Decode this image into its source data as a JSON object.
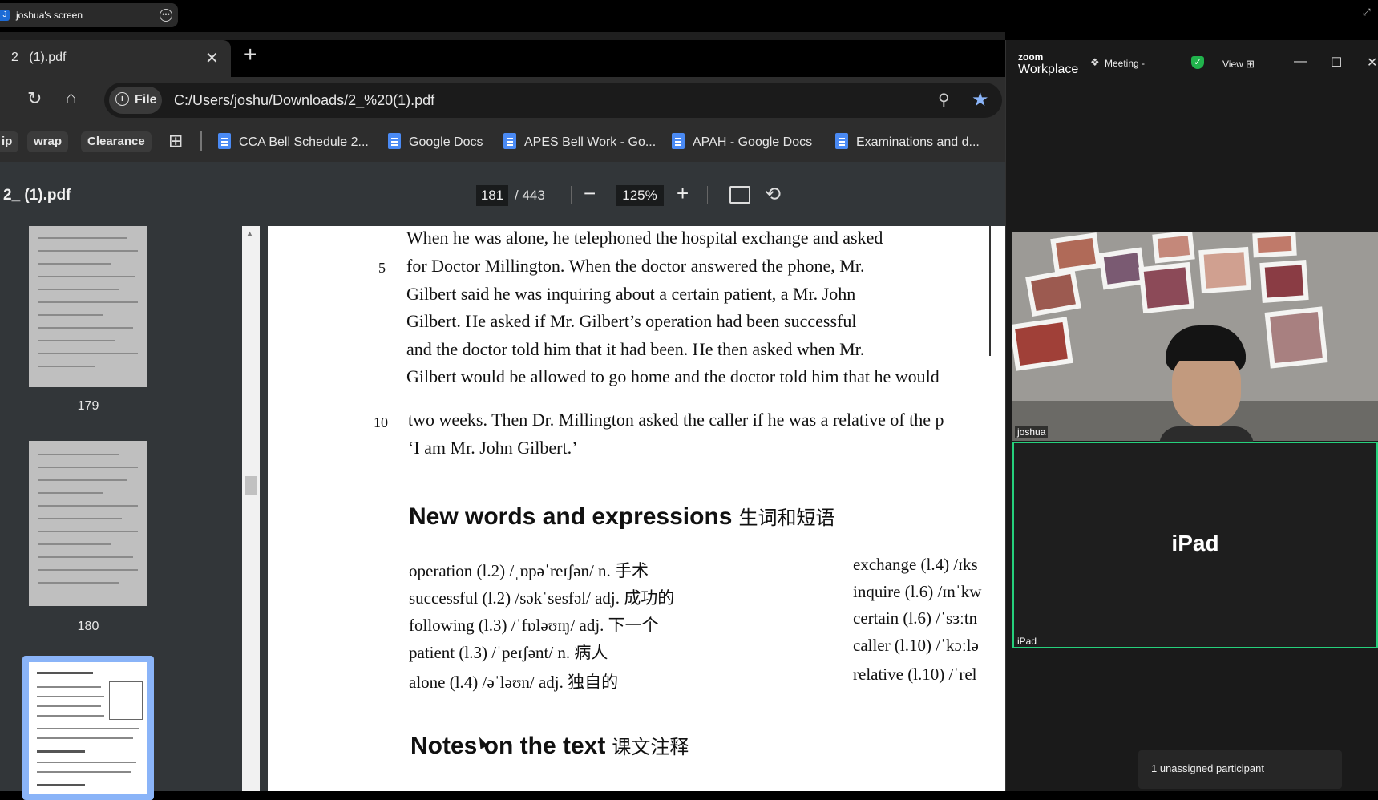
{
  "share": {
    "title": "joshua's screen",
    "icon_letter": "J"
  },
  "browser": {
    "tab_title": "2_ (1).pdf",
    "file_chip": "File",
    "url": "C:/Users/joshu/Downloads/2_%20(1).pdf",
    "bookmarks_chips": [
      "ip",
      "wrap",
      "Clearance"
    ],
    "bookmarks": [
      "CCA Bell Schedule 2...",
      "Google Docs",
      "APES Bell Work - Go...",
      "APAH - Google Docs",
      "Examinations and d..."
    ]
  },
  "pdf": {
    "title": "2_ (1).pdf",
    "current_page": "181",
    "total_pages": "/ 443",
    "zoom": "125%",
    "thumbnails": [
      "179",
      "180"
    ],
    "line_numbers": [
      "5",
      "10"
    ],
    "text_lines": [
      "When he was alone, he telephoned the hospital exchange and asked",
      "for Doctor Millington. When the doctor answered the phone, Mr.",
      "Gilbert said he was inquiring about a certain patient, a Mr. John",
      "Gilbert. He asked if Mr. Gilbert’s operation had been successful",
      "and the doctor told him that it had been. He then asked when Mr.",
      "Gilbert would be allowed to go home and the doctor told him that he would",
      "two weeks. Then Dr. Millington asked the caller if he was a relative of the p",
      "‘I am Mr. John Gilbert.’"
    ],
    "heading1": "New words and expressions",
    "heading1_cn": "生词和短语",
    "vocab_left": [
      "operation (l.2) /ˌɒpəˈreɪʃən/ n. 手术",
      "successful (l.2) /səkˈsesfəl/ adj. 成功的",
      "following (l.3) /ˈfɒləʊɪŋ/ adj. 下一个",
      "patient (l.3) /ˈpeɪʃənt/ n. 病人",
      "alone (l.4) /əˈləʊn/ adj. 独自的"
    ],
    "vocab_right": [
      "exchange (l.4) /ɪks",
      "inquire (l.6) /ɪnˈkw",
      "certain (l.6) /ˈsɜːtn",
      "caller (l.10) /ˈkɔːlə",
      "relative (l.10) /ˈrel"
    ],
    "heading2": "Notes on the text",
    "heading2_cn": "课文注释"
  },
  "zoom": {
    "brand_top": "zoom",
    "brand_bottom": "Workplace",
    "meeting_label": "Meeting -",
    "view_label": "View",
    "participant1": "joshua",
    "participant2_big": "iPad",
    "participant2": "iPad",
    "unassigned": "1 unassigned participant"
  },
  "colors": {
    "accent": "#8ab4f8",
    "zoom_active_border": "#26d07c",
    "shield": "#21b34c"
  }
}
